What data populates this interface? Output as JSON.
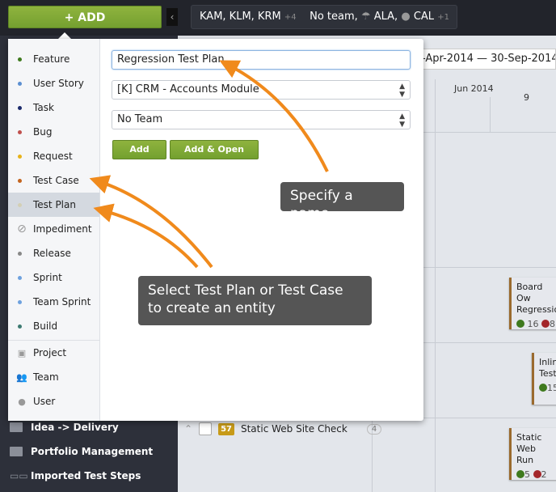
{
  "topbar": {
    "add_label": "+ ADD",
    "collapse_icon": "chevron-left-icon",
    "filter": {
      "people": "KAM, KLM, KRM",
      "people_more": "+4",
      "teams": "No team,",
      "team1": "ALA,",
      "team2": "CAL",
      "teams_more": "+1"
    }
  },
  "timeline": {
    "date_range": "-Apr-2014 — 30-Sep-2014",
    "month": "Jun 2014",
    "day": "9"
  },
  "sidebar": {
    "items": [
      {
        "label": "Idea -> Delivery",
        "icon": "folder-icon"
      },
      {
        "label": "Portfolio Management",
        "icon": "folder-icon"
      },
      {
        "label": "Imported Test Steps",
        "icon": "grid-icon"
      }
    ]
  },
  "list": {
    "row": {
      "id": "57",
      "title": "Static Web Site Check",
      "count": "4"
    }
  },
  "cards": [
    {
      "line1": "Board Ow",
      "line2": "Regressio",
      "passed": "16",
      "failed": "8"
    },
    {
      "line1": "Inlin",
      "line2": "Test:",
      "passed": "15"
    },
    {
      "line1": "Static Web",
      "line2": "Run",
      "passed": "5",
      "failed": "2"
    }
  ],
  "menu": {
    "entities": [
      {
        "label": "Feature",
        "color": "#3f7a1e"
      },
      {
        "label": "User Story",
        "color": "#5b8fd1"
      },
      {
        "label": "Task",
        "color": "#1b2a6b"
      },
      {
        "label": "Bug",
        "color": "#c0504d"
      },
      {
        "label": "Request",
        "color": "#e8b21a"
      },
      {
        "label": "Test Case",
        "color": "#c4651f"
      },
      {
        "label": "Test Plan",
        "color": "#d3cfb5",
        "selected": true
      },
      {
        "label": "Impediment",
        "icon": "no-entry-icon"
      },
      {
        "label": "Release",
        "color": "#888888"
      },
      {
        "label": "Sprint",
        "color": "#6ea1de"
      },
      {
        "label": "Team Sprint",
        "color": "#6ea1de"
      },
      {
        "label": "Build",
        "color": "#3d7a72"
      }
    ],
    "others": [
      {
        "label": "Project",
        "icon": "briefcase-icon"
      },
      {
        "label": "Team",
        "icon": "team-icon"
      },
      {
        "label": "User",
        "icon": "user-icon"
      }
    ]
  },
  "form": {
    "name_value": "Regression Test Plan",
    "project_value": "[K] CRM - Accounts Module",
    "team_value": "No Team",
    "add_label": "Add",
    "add_open_label": "Add & Open"
  },
  "tips": {
    "name": "Specify a name",
    "select_line1": "Select Test Plan or Test Case",
    "select_line2": "to create an entity"
  },
  "colors": {
    "accent_green": "#7ea836",
    "arrow": "#f08a1c"
  }
}
